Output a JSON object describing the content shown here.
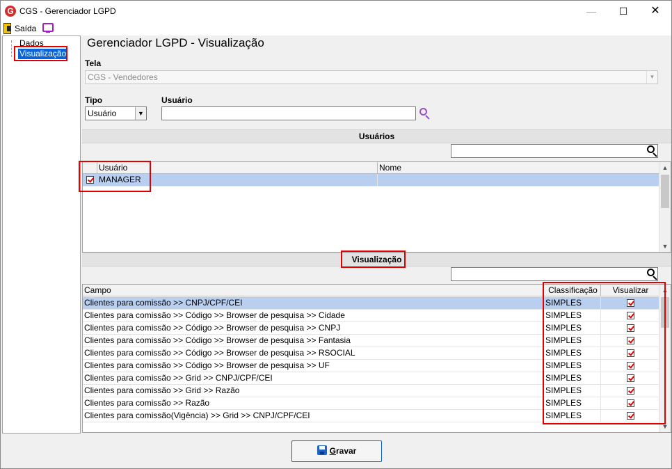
{
  "window": {
    "title": "CGS - Gerenciador LGPD",
    "app_icon_letter": "G",
    "min_symbol": "—",
    "max_symbol": "☐",
    "close_symbol": "✕"
  },
  "menu": {
    "exit_label": "Saída"
  },
  "sidebar": {
    "items": [
      {
        "label": "Dados"
      },
      {
        "label": "Visualização"
      }
    ]
  },
  "main": {
    "title": "Gerenciador LGPD - Visualização",
    "tela_label": "Tela",
    "tela_value": "CGS - Vendedores",
    "tipo_label": "Tipo",
    "tipo_value": "Usuário",
    "usuario_label": "Usuário",
    "usuario_value": ""
  },
  "users_section": {
    "title": "Usuários",
    "filter_value": "",
    "columns": [
      "Usuário",
      "Nome"
    ],
    "rows": [
      {
        "checked": true,
        "usuario": "MANAGER",
        "nome": ""
      }
    ]
  },
  "view_section": {
    "title": "Visualização",
    "filter_value": "",
    "columns": [
      "Campo",
      "Classificação",
      "Visualizar"
    ],
    "rows": [
      {
        "campo": "Clientes para comissão >> CNPJ/CPF/CEI",
        "classificacao": "SIMPLES",
        "visualizar": true
      },
      {
        "campo": "Clientes para comissão >> Código >> Browser de pesquisa >> Cidade",
        "classificacao": "SIMPLES",
        "visualizar": true
      },
      {
        "campo": "Clientes para comissão >> Código >> Browser de pesquisa >> CNPJ",
        "classificacao": "SIMPLES",
        "visualizar": true
      },
      {
        "campo": "Clientes para comissão >> Código >> Browser de pesquisa >> Fantasia",
        "classificacao": "SIMPLES",
        "visualizar": true
      },
      {
        "campo": "Clientes para comissão >> Código >> Browser de pesquisa >> RSOCIAL",
        "classificacao": "SIMPLES",
        "visualizar": true
      },
      {
        "campo": "Clientes para comissão >> Código >> Browser de pesquisa >> UF",
        "classificacao": "SIMPLES",
        "visualizar": true
      },
      {
        "campo": "Clientes para comissão >> Grid >> CNPJ/CPF/CEI",
        "classificacao": "SIMPLES",
        "visualizar": true
      },
      {
        "campo": "Clientes para comissão >> Grid >> Razão",
        "classificacao": "SIMPLES",
        "visualizar": true
      },
      {
        "campo": "Clientes para comissão >> Razão",
        "classificacao": "SIMPLES",
        "visualizar": true
      },
      {
        "campo": "Clientes para comissão(Vigência) >> Grid >> CNPJ/CPF/CEI",
        "classificacao": "SIMPLES",
        "visualizar": true
      }
    ]
  },
  "footer": {
    "save_label_accel": "G",
    "save_label_rest": "ravar"
  },
  "colors": {
    "highlight": "#e00000",
    "selection": "#b8cff0",
    "accent": "#0a64d8"
  }
}
